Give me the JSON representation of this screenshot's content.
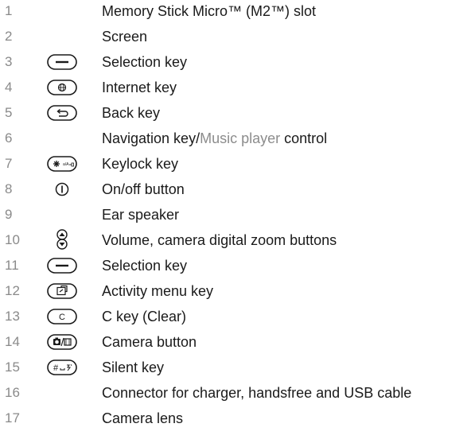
{
  "items": [
    {
      "number": "1",
      "label": "Memory Stick Micro™ (M2™) slot",
      "icon": ""
    },
    {
      "number": "2",
      "label": "Screen",
      "icon": ""
    },
    {
      "number": "3",
      "label": "Selection key",
      "icon": "selection-key-icon"
    },
    {
      "number": "4",
      "label": "Internet key",
      "icon": "internet-key-icon"
    },
    {
      "number": "5",
      "label": "Back key",
      "icon": "back-key-icon"
    },
    {
      "number": "6",
      "label_before": "Navigation key/",
      "label_link": "Music player",
      "label_after": " control",
      "icon": ""
    },
    {
      "number": "7",
      "label": "Keylock key",
      "icon": "keylock-key-icon"
    },
    {
      "number": "8",
      "label": "On/off button",
      "icon": "power-icon"
    },
    {
      "number": "9",
      "label": "Ear speaker",
      "icon": ""
    },
    {
      "number": "10",
      "label": "Volume, camera digital zoom buttons",
      "icon": "volume-buttons-icon"
    },
    {
      "number": "11",
      "label": "Selection key",
      "icon": "selection-key-icon"
    },
    {
      "number": "12",
      "label": "Activity menu key",
      "icon": "activity-menu-key-icon"
    },
    {
      "number": "13",
      "label": "C key (Clear)",
      "icon": "c-key-icon"
    },
    {
      "number": "14",
      "label": "Camera button",
      "icon": "camera-button-icon"
    },
    {
      "number": "15",
      "label": "Silent key",
      "icon": "silent-key-icon"
    },
    {
      "number": "16",
      "label": "Connector for charger, handsfree and USB cable",
      "icon": ""
    },
    {
      "number": "17",
      "label": "Camera lens",
      "icon": ""
    }
  ],
  "colors": {
    "number_gray": "#8a8a8a",
    "text": "#1a1a1a",
    "link_gray": "#8c8c8c"
  },
  "icon_glyphs": {
    "c_key": "C",
    "keylock_small": "a/A",
    "silent_hash": "#"
  }
}
